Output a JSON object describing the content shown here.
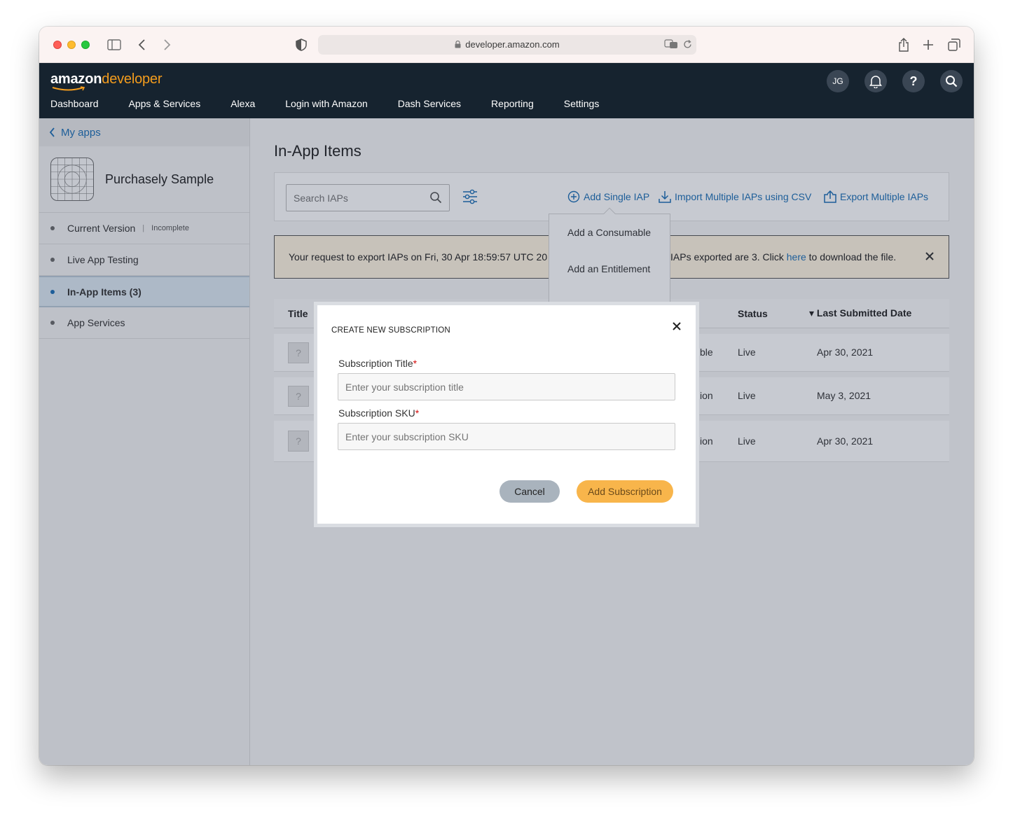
{
  "browser": {
    "url": "developer.amazon.com"
  },
  "header": {
    "logo_amazon": "amazon",
    "logo_developer": "developer",
    "nav": [
      "Dashboard",
      "Apps & Services",
      "Alexa",
      "Login with Amazon",
      "Dash Services",
      "Reporting",
      "Settings"
    ],
    "avatar": "JG",
    "help": "?"
  },
  "sidebar": {
    "back_label": "My apps",
    "app_name": "Purchasely Sample",
    "items": [
      {
        "label": "Current Version",
        "sep": "|",
        "status": "Incomplete"
      },
      {
        "label": "Live App Testing"
      },
      {
        "label": "In-App Items (3)"
      },
      {
        "label": "App Services"
      }
    ]
  },
  "main": {
    "title": "In-App Items",
    "search_placeholder": "Search IAPs",
    "actions": {
      "add_single": "Add Single IAP",
      "import": "Import Multiple IAPs using CSV",
      "export": "Export Multiple IAPs"
    },
    "dropdown": [
      "Add a Consumable",
      "Add an Entitlement"
    ],
    "banner": {
      "left": "Your request to export IAPs on Fri, 30 Apr 18:59:57 UTC 20",
      "right_a": "IAPs exported are 3. Click ",
      "link": "here",
      "right_b": " to download the file."
    },
    "table": {
      "headers": {
        "title": "Title",
        "status": "Status",
        "date": "▾ Last Submitted Date"
      },
      "rows": [
        {
          "thumb": "?",
          "type": "ble",
          "status": "Live",
          "date": "Apr 30, 2021"
        },
        {
          "thumb": "?",
          "type": "ion",
          "status": "Live",
          "date": "May 3, 2021"
        },
        {
          "thumb": "?",
          "type": "ion",
          "status": "Live",
          "date": "Apr 30, 2021"
        }
      ]
    }
  },
  "modal": {
    "title": "CREATE NEW SUBSCRIPTION",
    "title_field_label": "Subscription Title",
    "title_field_placeholder": "Enter your subscription title",
    "sku_field_label": "Subscription SKU",
    "sku_field_placeholder": "Enter your subscription SKU",
    "required_mark": "*",
    "cancel": "Cancel",
    "submit": "Add Subscription"
  },
  "colors": {
    "header_bg": "#16232f",
    "brand_orange": "#f39c1d",
    "link_blue": "#1c6fb5",
    "primary_button": "#f8b54b"
  }
}
